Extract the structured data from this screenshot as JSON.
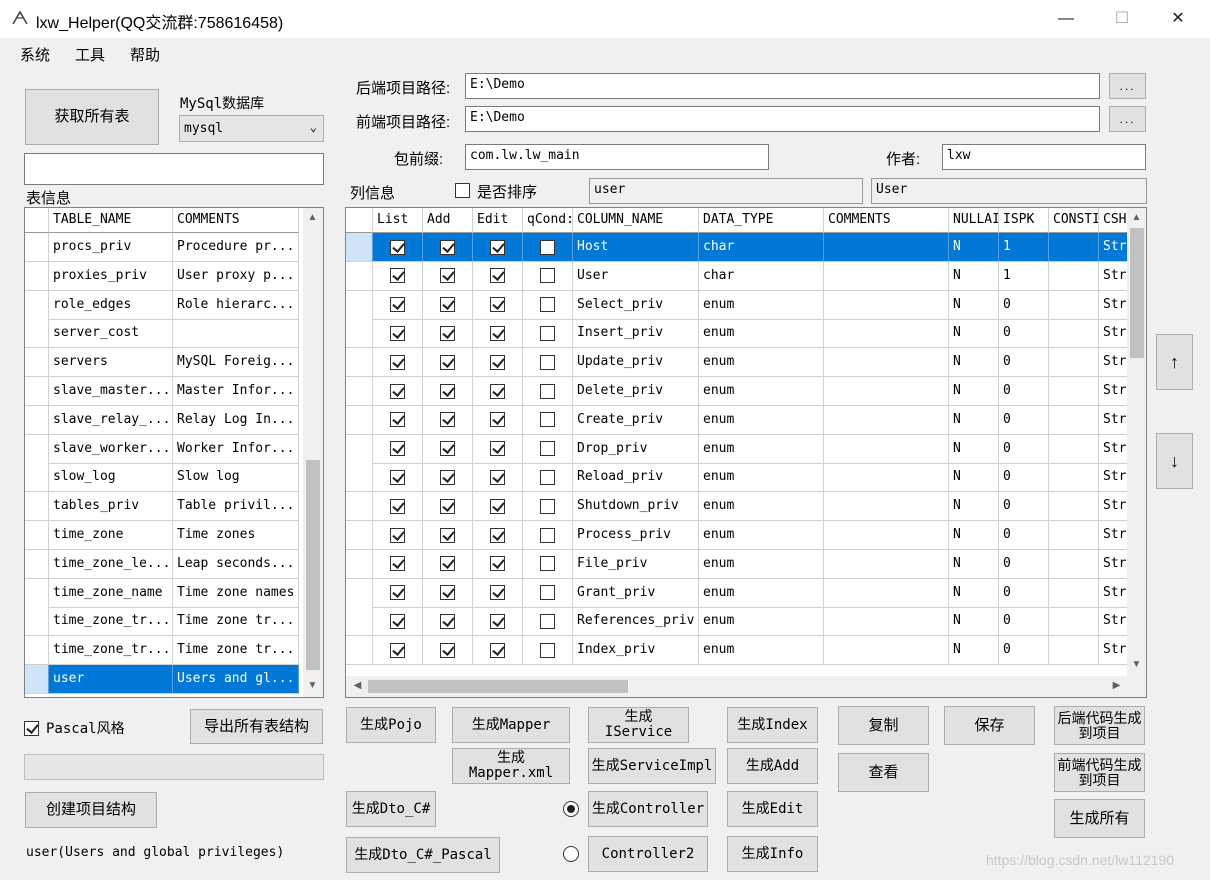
{
  "window": {
    "title": "lxw_Helper(QQ交流群:758616458)",
    "minimize": "—",
    "maximize": "☐",
    "close": "✕",
    "icon": "app-logo-icon"
  },
  "menu": [
    "系统",
    "工具",
    "帮助"
  ],
  "left": {
    "get_tables_button": "获取所有表",
    "db_label": "MySql数据库",
    "db_selected": "mysql",
    "search_value": "",
    "table_info_label": "表信息",
    "table_headers": [
      "TABLE_NAME",
      "COMMENTS"
    ],
    "tables": [
      [
        "procs_priv",
        "Procedure pr..."
      ],
      [
        "proxies_priv",
        "User proxy p..."
      ],
      [
        "role_edges",
        "Role hierarc..."
      ],
      [
        "server_cost",
        ""
      ],
      [
        "servers",
        "MySQL Foreig..."
      ],
      [
        "slave_master...",
        "Master Infor..."
      ],
      [
        "slave_relay_...",
        "Relay Log In..."
      ],
      [
        "slave_worker...",
        "Worker Infor..."
      ],
      [
        "slow_log",
        "Slow log"
      ],
      [
        "tables_priv",
        "Table privil..."
      ],
      [
        "time_zone",
        "Time zones"
      ],
      [
        "time_zone_le...",
        "Leap seconds..."
      ],
      [
        "time_zone_name",
        "Time zone names"
      ],
      [
        "time_zone_tr...",
        "Time zone tr..."
      ],
      [
        "time_zone_tr...",
        "Time zone tr..."
      ],
      [
        "user",
        "Users and gl..."
      ]
    ],
    "selected_table_index": 15,
    "pascal_label": "Pascal风格",
    "pascal_checked": true,
    "export_button": "导出所有表结构",
    "progress_fraction": 0,
    "create_project_button": "创建项目结构",
    "status_text": "user(Users and global privileges)"
  },
  "paths": {
    "backend_label": "后端项目路径:",
    "backend_value": "E:\\Demo",
    "frontend_label": "前端项目路径:",
    "frontend_value": "E:\\Demo",
    "browse_label": "...",
    "package_label": "包前缀:",
    "package_value": "com.lw.lw_main",
    "author_label": "作者:",
    "author_value": "lxw",
    "columns_label": "列信息",
    "sort_label": "是否排序",
    "sort_checked": false,
    "table_name_value": "user",
    "class_name_value": "User"
  },
  "columns_grid": {
    "headers": [
      "List",
      "Add",
      "Edit",
      "qCond:",
      "COLUMN_NAME",
      "DATA_TYPE",
      "COMMENTS",
      "NULLAI",
      "ISPK",
      "CONSTI",
      "CSH"
    ],
    "rows": [
      [
        "Host",
        "char",
        "",
        "N",
        "1",
        "",
        "Str:"
      ],
      [
        "User",
        "char",
        "",
        "N",
        "1",
        "",
        "Str:"
      ],
      [
        "Select_priv",
        "enum",
        "",
        "N",
        "0",
        "",
        "Str:"
      ],
      [
        "Insert_priv",
        "enum",
        "",
        "N",
        "0",
        "",
        "Str:"
      ],
      [
        "Update_priv",
        "enum",
        "",
        "N",
        "0",
        "",
        "Str:"
      ],
      [
        "Delete_priv",
        "enum",
        "",
        "N",
        "0",
        "",
        "Str:"
      ],
      [
        "Create_priv",
        "enum",
        "",
        "N",
        "0",
        "",
        "Str:"
      ],
      [
        "Drop_priv",
        "enum",
        "",
        "N",
        "0",
        "",
        "Str:"
      ],
      [
        "Reload_priv",
        "enum",
        "",
        "N",
        "0",
        "",
        "Str:"
      ],
      [
        "Shutdown_priv",
        "enum",
        "",
        "N",
        "0",
        "",
        "Str:"
      ],
      [
        "Process_priv",
        "enum",
        "",
        "N",
        "0",
        "",
        "Str:"
      ],
      [
        "File_priv",
        "enum",
        "",
        "N",
        "0",
        "",
        "Str:"
      ],
      [
        "Grant_priv",
        "enum",
        "",
        "N",
        "0",
        "",
        "Str:"
      ],
      [
        "References_priv",
        "enum",
        "",
        "N",
        "0",
        "",
        "Str:"
      ],
      [
        "Index_priv",
        "enum",
        "",
        "N",
        "0",
        "",
        "Str:"
      ]
    ],
    "selected_row_index": 0,
    "up_button": "↑",
    "down_button": "↓"
  },
  "actions": {
    "gen_pojo": "生成Pojo",
    "gen_mapper": "生成Mapper",
    "gen_iservice": "生成IService",
    "gen_index": "生成Index",
    "copy": "复制",
    "save": "保存",
    "backend_to_project": "后端代码生成到项目",
    "gen_mapper_xml": "生成Mapper.xml",
    "gen_serviceimpl": "生成ServiceImpl",
    "gen_add": "生成Add",
    "view": "查看",
    "frontend_to_project": "前端代码生成到项目",
    "gen_dto_cs": "生成Dto_C#",
    "gen_controller": "生成Controller",
    "gen_edit": "生成Edit",
    "gen_all": "生成所有",
    "gen_dto_cs_pascal": "生成Dto_C#_Pascal",
    "controller2": "Controller2",
    "gen_info": "生成Info",
    "controller_radio_on": true
  },
  "watermark": "https://blog.csdn.net/lw112190"
}
